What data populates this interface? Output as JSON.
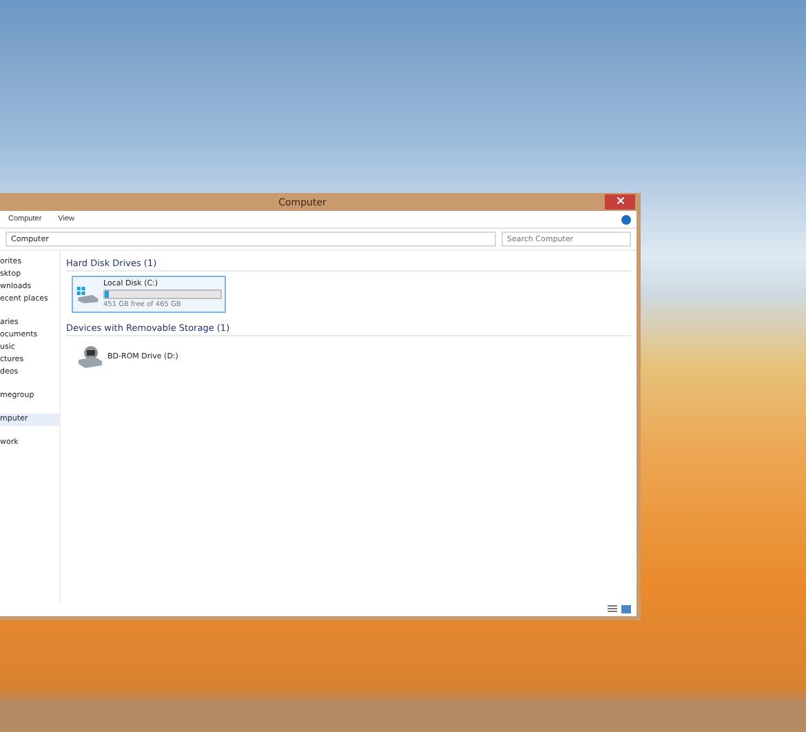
{
  "window": {
    "title": "Computer"
  },
  "ribbon_tabs": [
    {
      "label": "Computer",
      "selected": false
    },
    {
      "label": "View",
      "selected": false
    }
  ],
  "address": {
    "path": "Computer"
  },
  "search": {
    "placeholder": "Search Computer"
  },
  "sidebar": {
    "sections": [
      {
        "items": [
          {
            "label": "orites",
            "selected": false
          },
          {
            "label": "sktop",
            "selected": false
          },
          {
            "label": "wnloads",
            "selected": false
          },
          {
            "label": "ecent places",
            "selected": false
          }
        ]
      },
      {
        "items": [
          {
            "label": "aries",
            "selected": false
          },
          {
            "label": "ocuments",
            "selected": false
          },
          {
            "label": "usic",
            "selected": false
          },
          {
            "label": "ctures",
            "selected": false
          },
          {
            "label": "deos",
            "selected": false
          }
        ]
      },
      {
        "items": [
          {
            "label": "megroup",
            "selected": false
          }
        ]
      },
      {
        "items": [
          {
            "label": "mputer",
            "selected": true
          }
        ]
      },
      {
        "items": [
          {
            "label": "work",
            "selected": false
          }
        ]
      }
    ]
  },
  "groups": [
    {
      "title": "Hard Disk Drives (1)",
      "items": [
        {
          "kind": "disk",
          "name": "Local Disk (C:)",
          "level": 0.03,
          "free": "451 GB free of 465 GB",
          "selected": true
        }
      ]
    },
    {
      "title": "Devices with Removable Storage (1)",
      "items": [
        {
          "kind": "optical",
          "name": "BD-ROM Drive (D:)",
          "selected": false
        }
      ]
    }
  ]
}
